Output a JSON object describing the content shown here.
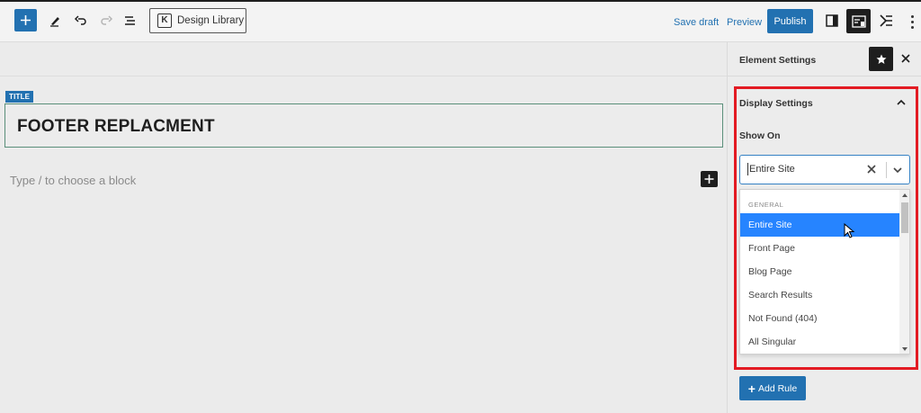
{
  "toolbar": {
    "design_library_label": "Design Library",
    "design_library_logo": "K",
    "save_draft_label": "Save draft",
    "preview_label": "Preview",
    "publish_label": "Publish"
  },
  "editor": {
    "title_tag": "TITLE",
    "title_text": "FOOTER REPLACMENT",
    "placeholder": "Type / to choose a block"
  },
  "sidebar": {
    "title": "Element Settings",
    "panel_title": "Display Settings",
    "show_on_label": "Show On",
    "select_value": "Entire Site",
    "dropdown": {
      "group_heading": "GENERAL",
      "options": [
        "Entire Site",
        "Front Page",
        "Blog Page",
        "Search Results",
        "Not Found (404)",
        "All Singular"
      ],
      "selected_index": 0
    },
    "add_rule_label": "Add Rule"
  },
  "colors": {
    "accent": "#2271b1",
    "highlight_option": "#2684ff",
    "annotation_border": "#e31b23"
  },
  "icons": [
    "plus-icon",
    "pen-icon",
    "undo-icon",
    "redo-icon",
    "list-view-icon",
    "sidebar-toggle-icon",
    "kadence-icon",
    "tools-icon",
    "more-icon",
    "star-icon",
    "close-icon",
    "chevron-up-icon",
    "clear-icon",
    "chevron-down-icon",
    "cursor-icon"
  ]
}
